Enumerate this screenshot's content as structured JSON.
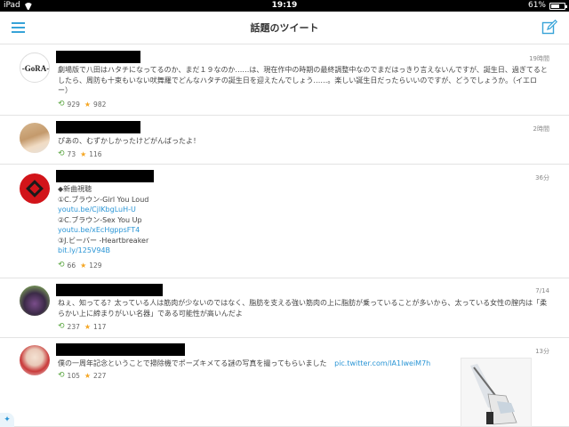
{
  "status_bar": {
    "device": "iPad",
    "time": "19:19",
    "battery": "61%",
    "battery_level": 0.61
  },
  "header": {
    "title": "話題のツイート"
  },
  "icons": {
    "menu": "menu-icon",
    "compose": "compose-icon",
    "retweet": "retweet-icon",
    "favorite": "star-icon",
    "app": "bird-icon"
  },
  "colors": {
    "accent": "#37a3d8",
    "link": "#2a95d5",
    "retweet": "#5aa640",
    "favorite": "#f5a623"
  },
  "tweets": [
    {
      "time": "19時間",
      "text": "劇場版で八田はハタチになってるのか、まだ１９なのか……は、現在作中の時期の最終調整中なのでまだはっきり言えないんですが、誕生日、過ぎてるとしたら、周防も十束もいない吠舞羅でどんなハタチの誕生日を迎えたんでしょう……。楽しい誕生日だったらいいのですが、どうでしょうか。（イエロー）",
      "retweets": "929",
      "favorites": "982",
      "avatar_text": "GoRA"
    },
    {
      "time": "2時間",
      "text": "ぴあの、むずかしかったけどがんばったよ！",
      "retweets": "73",
      "favorites": "116"
    },
    {
      "time": "36分",
      "lines": [
        "◆新曲視聴",
        "①C.ブラウン-Girl You Loud",
        "youtu.be/CjIKbgLuH-U",
        "②C.ブラウン-Sex You Up",
        "youtu.be/xEcHgppsFT4",
        "③J.ビーバー -Heartbreaker",
        "bit.ly/125V94B"
      ],
      "retweets": "66",
      "favorites": "129"
    },
    {
      "time": "7/14",
      "text": "ねぇ、知ってる？太っている人は筋肉が少ないのではなく、脂肪を支える強い筋肉の上に脂肪が乗っていることが多いから、太っている女性の膣内は「柔らかい上に締まりがいい名器」である可能性が高いんだよ",
      "retweets": "237",
      "favorites": "117"
    },
    {
      "time": "13分",
      "text": "僕の一周年記念ということで掃除機でポーズキメてる謎の写真を撮ってもらいました",
      "link": "pic.twitter.com/lA1IweiM7h",
      "retweets": "105",
      "favorites": "227"
    }
  ]
}
